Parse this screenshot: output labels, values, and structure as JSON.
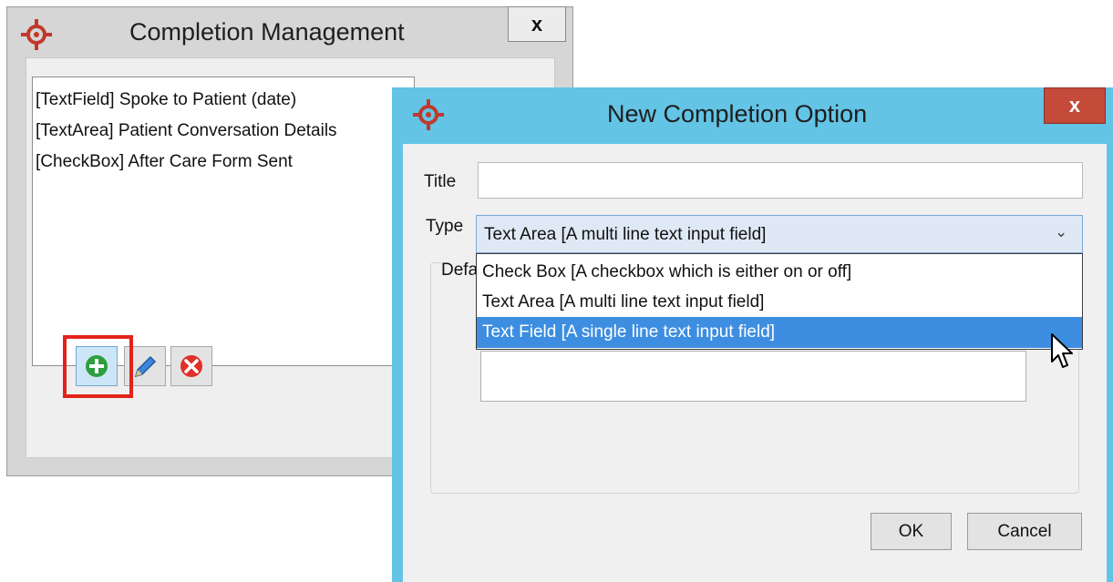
{
  "completion_management": {
    "title": "Completion Management",
    "close_label": "x",
    "items": [
      "[TextField] Spoke to Patient (date)",
      "[TextArea] Patient Conversation Details",
      "[CheckBox] After Care Form Sent"
    ],
    "toolbar_icons": [
      "add-icon",
      "edit-pencil-icon",
      "delete-icon"
    ]
  },
  "new_completion_option": {
    "title": "New Completion Option",
    "close_label": "x",
    "title_label": "Title",
    "title_value": "",
    "type_label": "Type",
    "type_value": "Text Area [A multi line text input field]",
    "default_label": "Defa",
    "type_options": [
      "Check Box [A checkbox which is either on or off]",
      "Text Area [A multi line text input field]",
      "Text Field [A single line text input field]"
    ],
    "highlighted_option_index": 2,
    "ok_label": "OK",
    "cancel_label": "Cancel"
  },
  "colors": {
    "dialog_frame": "#63c4e6",
    "close_button": "#c44a3a",
    "selection": "#3d8ee0",
    "highlight_box": "#e2231a",
    "logo": "#c0392b"
  }
}
